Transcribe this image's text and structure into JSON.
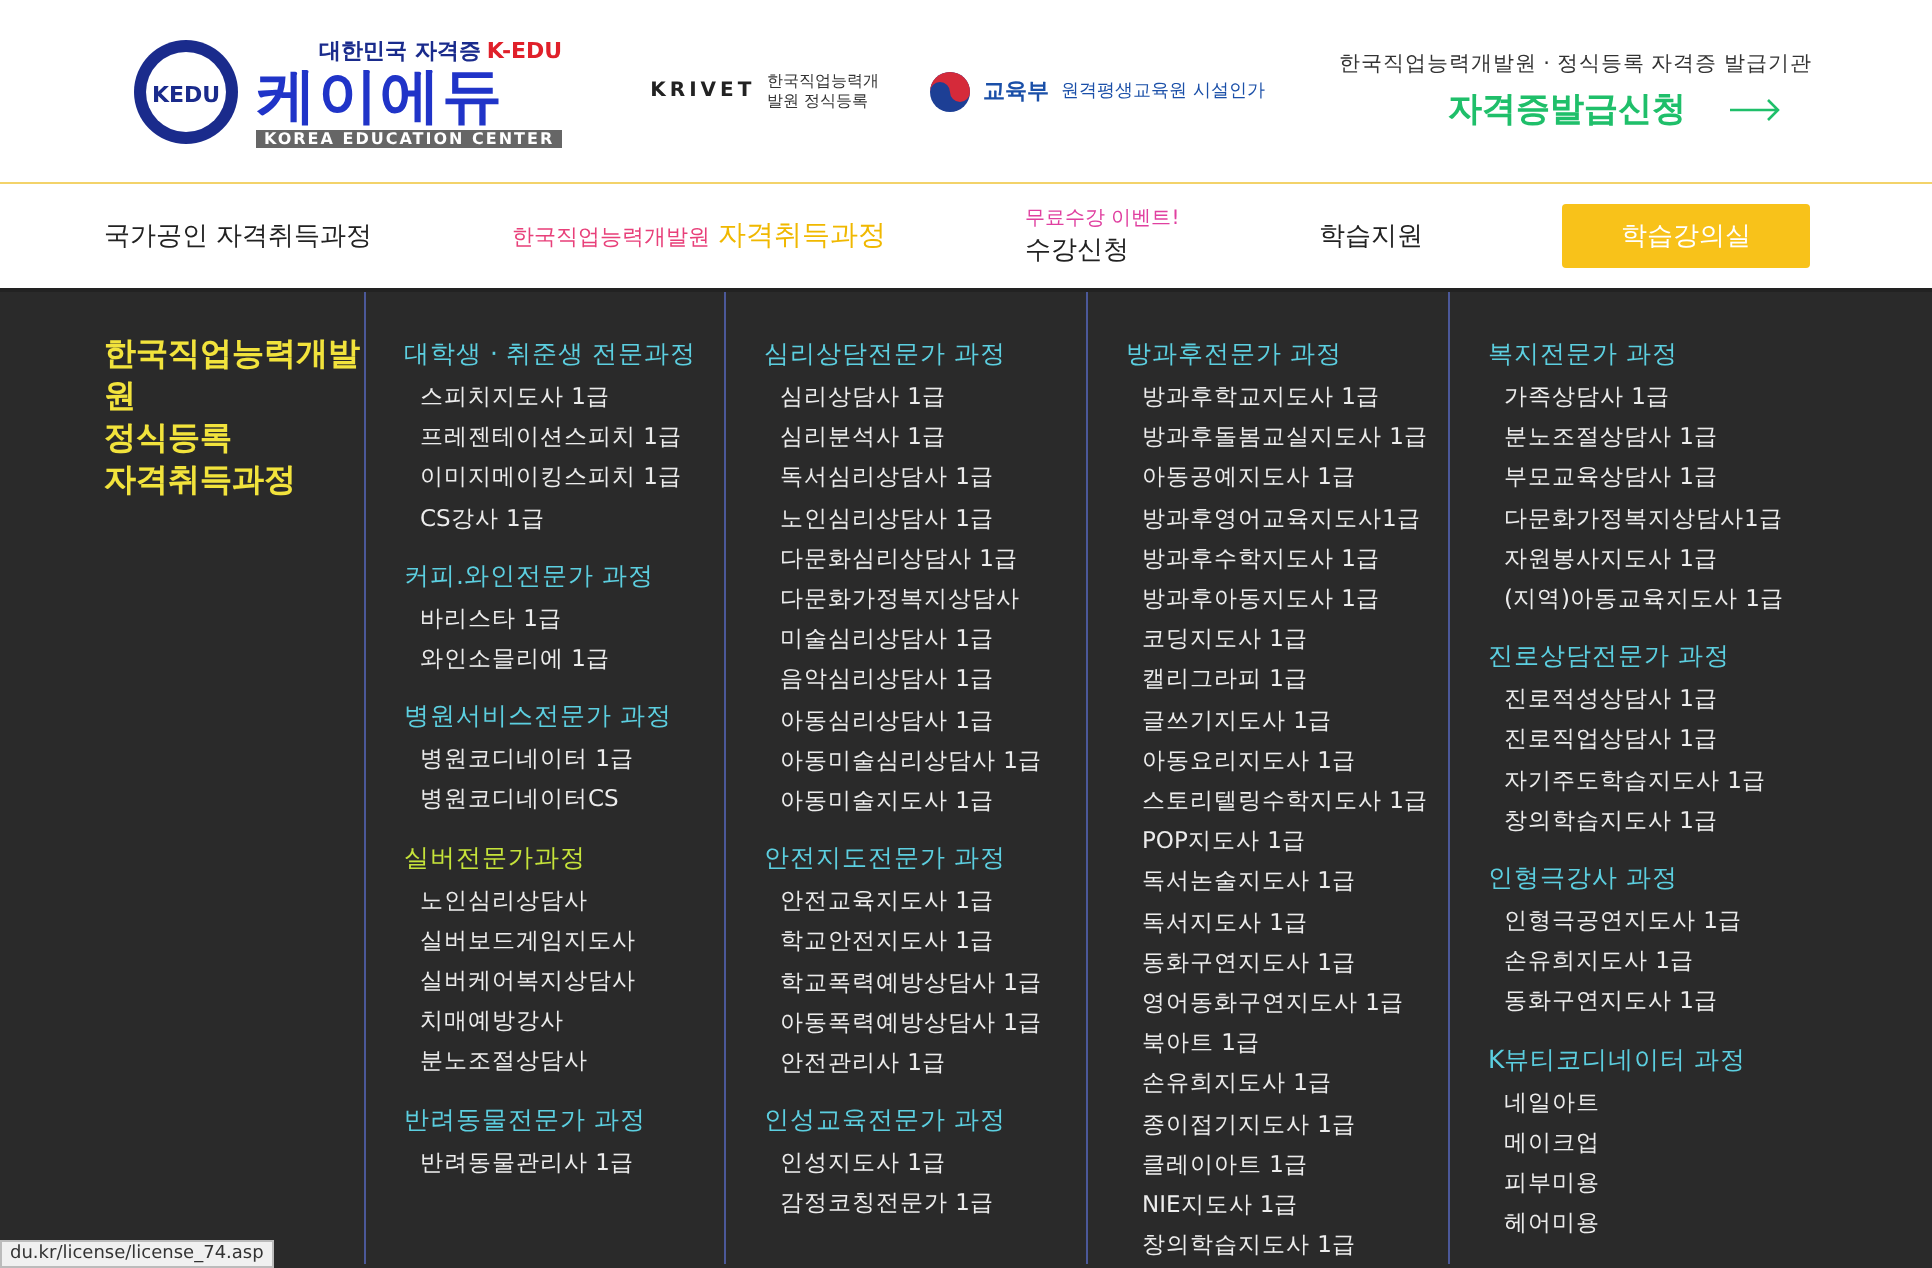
{
  "header": {
    "logo": {
      "emblem_text": "KEDU",
      "tagline": "대한민국 자격증",
      "tag_en": "K-EDU",
      "name": "케이에듀",
      "subtitle": "KOREA EDUCATION CENTER"
    },
    "partners": [
      {
        "kind": "krivet",
        "name": "KRIVET",
        "caption": "한국직업능력개발원 정식등록"
      },
      {
        "kind": "ministry",
        "name": "교육부",
        "caption": "원격평생교육원 시설인가"
      }
    ],
    "cta": {
      "caption": "한국직업능력개발원 · 정식등록 자격증 발급기관",
      "label": "자격증발급신청"
    }
  },
  "nav": [
    {
      "kind": "plain",
      "parts": [
        "국가공인 자격취득과정"
      ]
    },
    {
      "kind": "twotone",
      "parts": [
        "한국직업능력개발원",
        "자격취득과정"
      ]
    },
    {
      "kind": "event",
      "badge": "무료수강 이벤트!",
      "parts": [
        "수강신청"
      ]
    },
    {
      "kind": "plain",
      "parts": [
        "학습지원"
      ]
    },
    {
      "kind": "button",
      "parts": [
        "학습강의실"
      ]
    }
  ],
  "menu": {
    "title_lines": [
      "한국직업능력개발원",
      "정식등록",
      "자격취득과정"
    ],
    "columns": [
      {
        "groups": [
          {
            "title": "대학생 · 취준생 전문과정",
            "color": "#5ccfe0",
            "items": [
              "스피치지도사 1급",
              "프레젠테이션스피치 1급",
              "이미지메이킹스피치 1급",
              "CS강사 1급"
            ]
          },
          {
            "title": "커피.와인전문가 과정",
            "color": "#5ccfe0",
            "items": [
              "바리스타 1급",
              "와인소믈리에 1급"
            ]
          },
          {
            "title": "병원서비스전문가 과정",
            "color": "#5ccfe0",
            "items": [
              "병원코디네이터 1급",
              "병원코디네이터CS"
            ]
          },
          {
            "title": "실버전문가과정",
            "color": "#c6e43a",
            "items": [
              "노인심리상담사",
              "실버보드게임지도사",
              "실버케어복지상담사",
              "치매예방강사",
              "분노조절상담사"
            ]
          },
          {
            "title": "반려동물전문가 과정",
            "color": "#5ccfe0",
            "items": [
              "반려동물관리사 1급"
            ]
          }
        ]
      },
      {
        "groups": [
          {
            "title": "심리상담전문가 과정",
            "color": "#5ccfe0",
            "items": [
              "심리상담사 1급",
              "심리분석사 1급",
              "독서심리상담사 1급",
              "노인심리상담사 1급",
              "다문화심리상담사 1급",
              "다문화가정복지상담사",
              "미술심리상담사 1급",
              "음악심리상담사 1급",
              "아동심리상담사 1급",
              "아동미술심리상담사 1급",
              "아동미술지도사 1급"
            ]
          },
          {
            "title": "안전지도전문가 과정",
            "color": "#5ccfe0",
            "items": [
              "안전교육지도사 1급",
              "학교안전지도사 1급",
              "학교폭력예방상담사 1급",
              "아동폭력예방상담사 1급",
              "안전관리사 1급"
            ]
          },
          {
            "title": "인성교육전문가 과정",
            "color": "#5ccfe0",
            "items": [
              "인성지도사 1급",
              "감정코칭전문가 1급"
            ]
          }
        ]
      },
      {
        "groups": [
          {
            "title": "방과후전문가 과정",
            "color": "#5ccfe0",
            "items": [
              "방과후학교지도사 1급",
              "방과후돌봄교실지도사 1급",
              "아동공예지도사 1급",
              "방과후영어교육지도사1급",
              "방과후수학지도사 1급",
              "방과후아동지도사 1급",
              "코딩지도사 1급",
              "캘리그라피 1급",
              "글쓰기지도사 1급",
              "아동요리지도사 1급",
              "스토리텔링수학지도사 1급",
              "POP지도사 1급",
              "독서논술지도사 1급",
              "독서지도사 1급",
              "동화구연지도사 1급",
              "영어동화구연지도사 1급",
              "북아트 1급",
              "손유희지도사 1급",
              "종이접기지도사 1급",
              "클레이아트 1급",
              "NIE지도사 1급",
              "창의학습지도사 1급"
            ]
          }
        ]
      },
      {
        "groups": [
          {
            "title": "복지전문가 과정",
            "color": "#5ccfe0",
            "items": [
              "가족상담사 1급",
              "분노조절상담사 1급",
              "부모교육상담사 1급",
              "다문화가정복지상담사1급",
              "자원봉사지도사 1급",
              "(지역)아동교육지도사 1급"
            ]
          },
          {
            "title": "진로상담전문가 과정",
            "color": "#5ccfe0",
            "items": [
              "진로적성상담사 1급",
              "진로직업상담사 1급",
              "자기주도학습지도사 1급",
              "창의학습지도사 1급"
            ]
          },
          {
            "title": "인형극강사 과정",
            "color": "#5ccfe0",
            "items": [
              "인형극공연지도사 1급",
              "손유희지도사 1급",
              "동화구연지도사 1급"
            ]
          },
          {
            "title": "K뷰티코디네이터 과정",
            "color": "#5ccfe0",
            "items": [
              "네일아트",
              "메이크업",
              "피부미용",
              "헤어미용"
            ]
          }
        ]
      }
    ]
  },
  "status_bar": "du.kr/license/license_74.asp"
}
